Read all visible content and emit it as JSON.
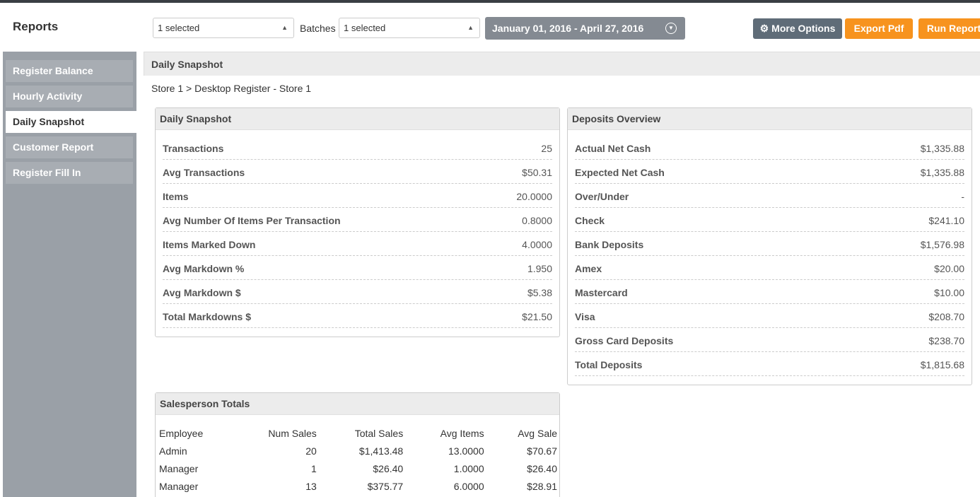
{
  "app_title": "Reports",
  "filters": {
    "store_select": "1 selected",
    "batches_label": "Batches",
    "batches_select": "1 selected",
    "date_range": "January 01, 2016 - April 27, 2016"
  },
  "actions": {
    "more_options": "More Options",
    "export_pdf": "Export Pdf",
    "run_report": "Run Report"
  },
  "colors": {
    "accent_orange": "#f7931e",
    "sidebar_bg": "#9aa0a7",
    "date_bg": "#848a92",
    "more_options_bg": "#5f6c78"
  },
  "sidebar": {
    "items": [
      {
        "label": "Register Balance",
        "active": false
      },
      {
        "label": "Hourly Activity",
        "active": false
      },
      {
        "label": "Daily Snapshot",
        "active": true
      },
      {
        "label": "Customer Report",
        "active": false
      },
      {
        "label": "Register Fill In",
        "active": false
      }
    ]
  },
  "main": {
    "header": "Daily Snapshot",
    "breadcrumb": "Store 1 > Desktop Register - Store 1"
  },
  "daily_snapshot": {
    "title": "Daily Snapshot",
    "rows": [
      {
        "label": "Transactions",
        "value": "25"
      },
      {
        "label": "Avg Transactions",
        "value": "$50.31"
      },
      {
        "label": "Items",
        "value": "20.0000"
      },
      {
        "label": "Avg Number Of Items Per Transaction",
        "value": "0.8000"
      },
      {
        "label": "Items Marked Down",
        "value": "4.0000"
      },
      {
        "label": "Avg Markdown %",
        "value": "1.950"
      },
      {
        "label": "Avg Markdown $",
        "value": "$5.38"
      },
      {
        "label": "Total Markdowns $",
        "value": "$21.50"
      }
    ]
  },
  "deposits_overview": {
    "title": "Deposits Overview",
    "rows": [
      {
        "label": "Actual Net Cash",
        "value": "$1,335.88"
      },
      {
        "label": "Expected Net Cash",
        "value": "$1,335.88"
      },
      {
        "label": "Over/Under",
        "value": "-"
      },
      {
        "label": "Check",
        "value": "$241.10"
      },
      {
        "label": "Bank Deposits",
        "value": "$1,576.98"
      },
      {
        "label": "Amex",
        "value": "$20.00"
      },
      {
        "label": "Mastercard",
        "value": "$10.00"
      },
      {
        "label": "Visa",
        "value": "$208.70"
      },
      {
        "label": "Gross Card Deposits",
        "value": "$238.70"
      },
      {
        "label": "Total Deposits",
        "value": "$1,815.68"
      }
    ]
  },
  "salesperson_totals": {
    "title": "Salesperson Totals",
    "columns": [
      "Employee",
      "Num Sales",
      "Total Sales",
      "Avg Items",
      "Avg Sale"
    ],
    "rows": [
      [
        "Admin",
        "20",
        "$1,413.48",
        "13.0000",
        "$70.67"
      ],
      [
        "Manager",
        "1",
        "$26.40",
        "1.0000",
        "$26.40"
      ],
      [
        "Manager",
        "13",
        "$375.77",
        "6.0000",
        "$28.91"
      ]
    ]
  }
}
